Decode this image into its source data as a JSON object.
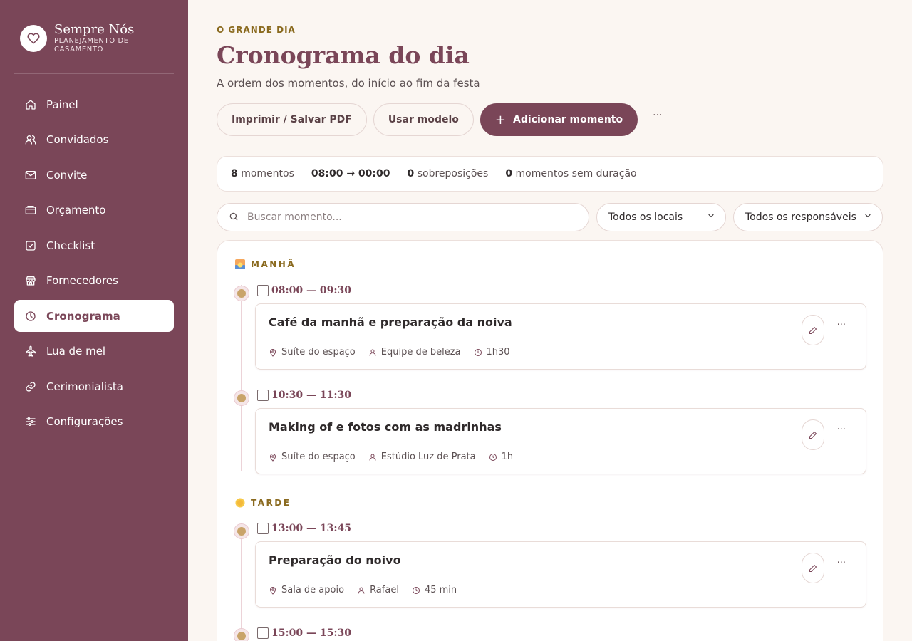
{
  "brand": {
    "name": "Sempre Nós",
    "subtitle": "PLANEJAMENTO DE CASAMENTO",
    "logo_icon": "heart-icon"
  },
  "sidebar": {
    "items": [
      {
        "label": "Painel",
        "icon": "home-icon"
      },
      {
        "label": "Convidados",
        "icon": "users-icon"
      },
      {
        "label": "Convite",
        "icon": "mail-icon"
      },
      {
        "label": "Orçamento",
        "icon": "wallet-icon"
      },
      {
        "label": "Checklist",
        "icon": "checkbox-icon"
      },
      {
        "label": "Fornecedores",
        "icon": "store-icon"
      },
      {
        "label": "Cronograma",
        "icon": "clock-icon",
        "active": true
      },
      {
        "label": "Lua de mel",
        "icon": "plane-icon"
      },
      {
        "label": "Cerimonialista",
        "icon": "link-icon"
      },
      {
        "label": "Configurações",
        "icon": "sliders-icon"
      }
    ]
  },
  "header": {
    "eyebrow": "O GRANDE DIA",
    "title": "Cronograma do dia",
    "subtitle": "A ordem dos momentos, do início ao fim da festa"
  },
  "actions": {
    "print_label": "Imprimir / Salvar PDF",
    "template_label": "Usar modelo",
    "add_label": "Adicionar momento",
    "more_label": "···"
  },
  "stats": {
    "moments_count": "8",
    "moments_label": "momentos",
    "range": "08:00 → 00:00",
    "overlaps_count": "0",
    "overlaps_label": "sobreposições",
    "no_duration_count": "0",
    "no_duration_label": "momentos sem duração"
  },
  "filters": {
    "search_placeholder": "Buscar momento...",
    "location_value": "Todos os locais",
    "responsible_value": "Todos os responsáveis"
  },
  "periods": {
    "morning": "MANHÃ",
    "afternoon": "TARDE"
  },
  "moments": [
    {
      "time": "08:00 — 09:30",
      "title": "Café da manhã e preparação da noiva",
      "location": "Suíte do espaço",
      "responsible": "Equipe de beleza",
      "duration": "1h30"
    },
    {
      "time": "10:30 — 11:30",
      "title": "Making of e fotos com as madrinhas",
      "location": "Suíte do espaço",
      "responsible": "Estúdio Luz de Prata",
      "duration": "1h"
    },
    {
      "time": "13:00 — 13:45",
      "title": "Preparação do noivo",
      "location": "Sala de apoio",
      "responsible": "Rafael",
      "duration": "45 min"
    },
    {
      "time": "15:00 — 15:30"
    }
  ],
  "colors": {
    "sidebar": "#7a4658",
    "accent": "#7a4658",
    "gold": "#c9a46a",
    "eyebrow": "#8a6a1f",
    "background": "#fbf6f2"
  }
}
